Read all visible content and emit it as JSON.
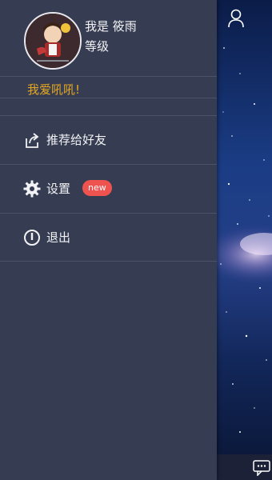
{
  "profile": {
    "username": "我是 筱雨",
    "level_label": "等级",
    "signature": "我爱吼吼!"
  },
  "menu": {
    "items": [
      {
        "label": "推荐给好友",
        "icon": "share-icon"
      },
      {
        "label": "设置",
        "icon": "gear-icon",
        "badge": "new"
      },
      {
        "label": "退出",
        "icon": "power-icon"
      }
    ]
  },
  "colors": {
    "drawer_bg": "#363d52",
    "signature": "#e4a621",
    "badge_bg": "#ef5350",
    "divider": "#4b5269"
  }
}
